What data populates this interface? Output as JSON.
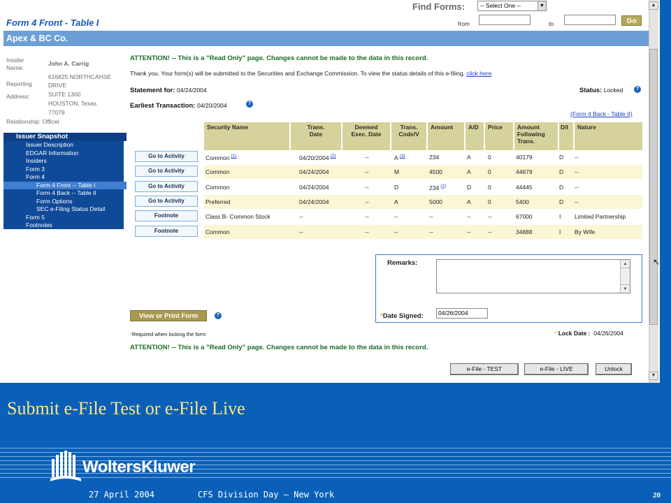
{
  "find_forms": {
    "label": "Find Forms:",
    "select": "-- Select One --",
    "from": "from",
    "to": "to",
    "go": "Go"
  },
  "page_title": "Form 4 Front - Table I",
  "company": "Apex & BC Co.",
  "insider": {
    "name_label": "Insider Name:",
    "name": "John A. Carrig",
    "address_label": "Reporting Address:",
    "address": [
      "616825 NORTHCAHSE",
      "DRIVE",
      "SUITE 1300",
      "HOUSTON, Texas",
      "77079"
    ],
    "relationship_label": "Relationship:",
    "relationship": "Officer"
  },
  "nav": {
    "header": "Issuer Snapshot",
    "items": [
      "Issuer Description",
      "EDGAR Information",
      "Insiders",
      "Form 3",
      "Form 4",
      "Form 4 Front -- Table I",
      "Form 4 Back -- Table II",
      "Form Options",
      "SEC e-Filing Status Detail",
      "Form 5",
      "Footnotes"
    ]
  },
  "attention": "ATTENTION! -- This is a \"Read Only\" page. Changes cannot be made to the data in this record.",
  "thanks": "Thank you. Your form(s) will be submitted to the Securities and Exchange Commission. To view the status details of this e-filing,",
  "click_here": "click here",
  "statement_label": "Statement for:",
  "statement_date": "04/24/2004",
  "status_label": "Status:",
  "status_value": "Locked",
  "earliest_label": "Earliest Transaction:",
  "earliest_date": "04/20/2004",
  "back_link": "(Form 4 Back - Table II)",
  "table": {
    "headers": [
      "Security Name",
      "Trans. Date",
      "Deemed Exec. Date",
      "Trans. Code/V",
      "Amount",
      "A/D",
      "Price",
      "Amount Following Trans.",
      "D/I",
      "Nature"
    ],
    "rows": [
      {
        "action": "Go to Activity",
        "security": "Common",
        "sec_fn": "(1)",
        "date": "04/20/2004",
        "date_fn": "(2)",
        "deemed": "--",
        "code": "A",
        "code_fn": "(3)",
        "amount": "234",
        "amt_fn": "",
        "ad": "A",
        "price": "0",
        "following": "40179",
        "di": "D",
        "nature": "--"
      },
      {
        "action": "Go to Activity",
        "security": "Common",
        "sec_fn": "",
        "date": "04/24/2004",
        "date_fn": "",
        "deemed": "--",
        "code": "M",
        "code_fn": "",
        "amount": "4500",
        "amt_fn": "",
        "ad": "A",
        "price": "0",
        "following": "44679",
        "di": "D",
        "nature": "--"
      },
      {
        "action": "Go to Activity",
        "security": "Common",
        "sec_fn": "",
        "date": "04/24/2004",
        "date_fn": "",
        "deemed": "--",
        "code": "D",
        "code_fn": "",
        "amount": "234",
        "amt_fn": "(2)",
        "ad": "D",
        "price": "0",
        "following": "44445",
        "di": "D",
        "nature": "--"
      },
      {
        "action": "Go to Activity",
        "security": "Preferred",
        "sec_fn": "",
        "date": "04/24/2004",
        "date_fn": "",
        "deemed": "--",
        "code": "A",
        "code_fn": "",
        "amount": "5000",
        "amt_fn": "",
        "ad": "A",
        "price": "0",
        "following": "5400",
        "di": "D",
        "nature": "--"
      },
      {
        "action": "Footnote",
        "security": "Class B- Common Stock",
        "sec_fn": "",
        "date": "--",
        "date_fn": "",
        "deemed": "--",
        "code": "--",
        "code_fn": "",
        "amount": "--",
        "amt_fn": "",
        "ad": "--",
        "price": "--",
        "following": "67000",
        "di": "I",
        "nature": "Limited Partnership"
      },
      {
        "action": "Footnote",
        "security": "Common",
        "sec_fn": "",
        "date": "--",
        "date_fn": "",
        "deemed": "--",
        "code": "--",
        "code_fn": "",
        "amount": "--",
        "amt_fn": "",
        "ad": "--",
        "price": "--",
        "following": "34888",
        "di": "I",
        "nature": "By Wife"
      }
    ]
  },
  "remarks_label": "Remarks:",
  "date_signed_label": "Date Signed:",
  "date_signed": "04/26/2004",
  "view_print": "View or Print Form",
  "required_note": "Required when locking the form",
  "lock_date_label": "Lock Date :",
  "lock_date": "04/26/2004",
  "buttons": {
    "test": "e-File - TEST",
    "live": "e-File - LIVE",
    "unlock": "Unlock"
  },
  "slide_caption": "Submit e-File Test or e-File Live",
  "logo_text": "WoltersKluwer",
  "footer": {
    "date": "27 April 2004",
    "event": "CFS Division Day – New York",
    "page": "20"
  },
  "colors": {
    "slide_bg": "#0a60b8",
    "header_bar": "#6c9fd6",
    "nav_bg": "#0f4a99",
    "table_header": "#d6d29c",
    "row_alt": "#fbf6d4",
    "caption": "#ffe680"
  }
}
